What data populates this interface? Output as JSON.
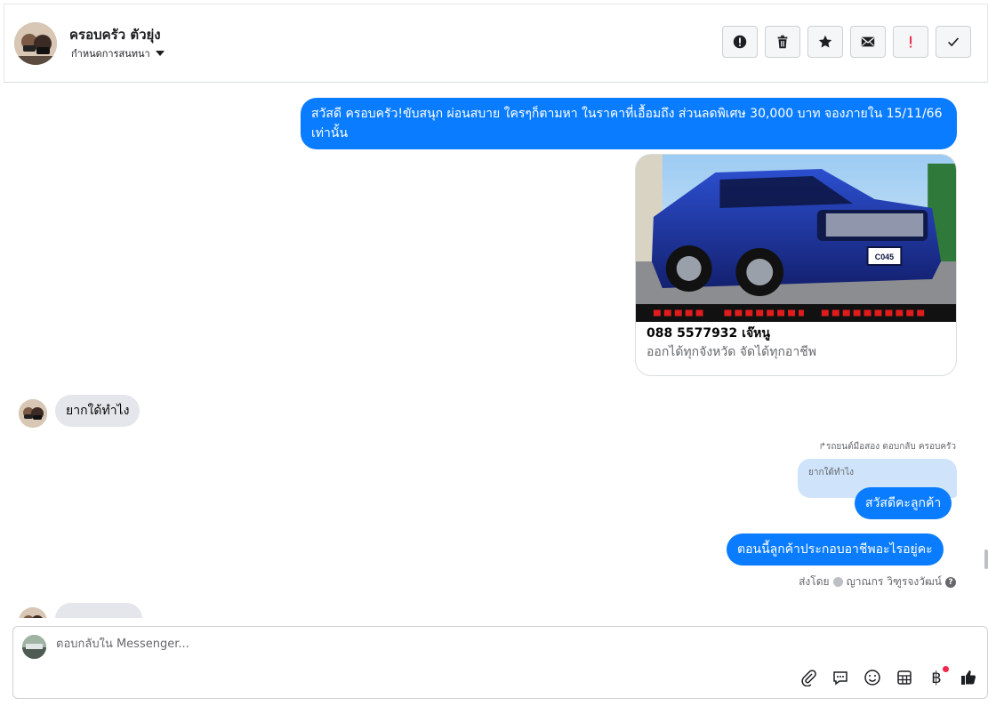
{
  "header": {
    "contact_name": "ครอบครัว ตัวยุ่ง",
    "assign_label": "กำหนดการสนทนา",
    "actions": [
      {
        "name": "spam-button",
        "icon": "exclamation-circle-icon"
      },
      {
        "name": "delete-button",
        "icon": "trash-icon"
      },
      {
        "name": "star-button",
        "icon": "star-icon"
      },
      {
        "name": "mark-unread-button",
        "icon": "envelope-icon"
      },
      {
        "name": "follow-up-button",
        "icon": "exclamation-red-icon"
      },
      {
        "name": "mark-done-button",
        "icon": "checkmark-icon"
      }
    ]
  },
  "messages": {
    "m1": "สวัสดี ครอบครัว!ขับสนุก ผ่อนสบาย ใครๆก็ตามหา ในราคาที่เอื้อมถึง ส่วนลดพิเศษ 30,000 บาท จองภายใน 15/11/66 เท่านั้น",
    "card_title": "088 5577932 เจ๊หนู",
    "card_subtitle": "ออกได้ทุกจังหวัด จัดได้ทุกอาชีพ",
    "card_plate": "C045",
    "incoming1": "ยากใด้ทำไง",
    "reply_meta": "รถยนต์มือสอง ตอบกลับ ครอบครัว",
    "quoted": "ยากใด้ทำไง",
    "reply1": "สวัสดีคะลูกค้า",
    "reply2": "ตอนนี้ลูกค้าประกอบอาชีพอะไรอยู่คะ",
    "sent_by_prefix": "ส่งโดย",
    "sent_by_name": "ญาณกร วิฑูรจงวัฒน์"
  },
  "composer": {
    "placeholder": "ตอบกลับใน Messenger..."
  },
  "colors": {
    "accent": "#0a7cff",
    "incoming_bubble": "#e4e6eb",
    "quoted_bubble": "#cfe3fb",
    "alert_red": "#f02849"
  }
}
